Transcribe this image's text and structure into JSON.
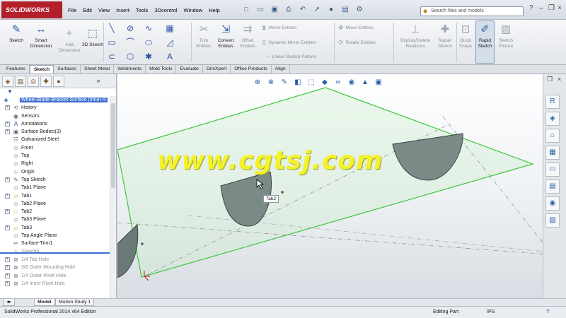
{
  "app": {
    "brand": "SOLIDWORKS",
    "menu": [
      "File",
      "Edit",
      "View",
      "Insert",
      "Tools",
      "3Dcontrol",
      "Window",
      "Help"
    ],
    "search_placeholder": "Search files and models"
  },
  "ribbon": {
    "sketch": "Sketch",
    "smart_dimension": "Smart Dimension",
    "add_dimension": "Add Dimension",
    "sketch_3d": "3D Sketch",
    "trim": "Trim Entities",
    "convert": "Convert Entities",
    "offset": "Offset Entities",
    "mirror": "Mirror Entities",
    "dynamic_mirror": "Dynamic Mirror Entities",
    "linear_pattern": "Linear Sketch Pattern",
    "move": "Move Entities",
    "rotate": "Rotate Entities",
    "display_delete": "Display/Delete Relations",
    "repair": "Repair Sketch",
    "quick_snaps": "Quick Snaps",
    "rapid_sketch": "Rapid Sketch",
    "sketch_picture": "Sketch Picture"
  },
  "tabs": [
    "Features",
    "Sketch",
    "Surfaces",
    "Sheet Metal",
    "Weldments",
    "Mold Tools",
    "Evaluate",
    "DimXpert",
    "Office Products",
    "Align"
  ],
  "active_tab": "Sketch",
  "tree": [
    {
      "label": "Wheel-Blade-Bracket-Surface  (Inner R",
      "icon": "part-icon",
      "sel": true,
      "expand": "",
      "indent": 0
    },
    {
      "label": "History",
      "icon": "history-icon",
      "expand": "+"
    },
    {
      "label": "Sensors",
      "icon": "sensors-icon",
      "expand": ""
    },
    {
      "label": "Annotations",
      "icon": "annotations-icon",
      "expand": "+"
    },
    {
      "label": "Surface Bodies(3)",
      "icon": "surface-bodies-icon",
      "expand": "+"
    },
    {
      "label": "Galvanized Steel",
      "icon": "material-icon",
      "expand": ""
    },
    {
      "label": "Front",
      "icon": "plane-icon",
      "expand": ""
    },
    {
      "label": "Top",
      "icon": "plane-icon",
      "expand": ""
    },
    {
      "label": "Right",
      "icon": "plane-icon",
      "expand": ""
    },
    {
      "label": "Origin",
      "icon": "origin-icon",
      "expand": ""
    },
    {
      "label": "Top Sketch",
      "icon": "sketch-icon",
      "expand": "+"
    },
    {
      "label": "Tab1 Plane",
      "icon": "plane-icon",
      "expand": ""
    },
    {
      "label": "Tab1",
      "icon": "surface-icon",
      "expand": "+"
    },
    {
      "label": "Tab2 Plane",
      "icon": "plane-icon",
      "expand": ""
    },
    {
      "label": "Tab2",
      "icon": "surface-icon",
      "expand": "+"
    },
    {
      "label": "Tab3 Plane",
      "icon": "plane-icon",
      "expand": ""
    },
    {
      "label": "Tab3",
      "icon": "surface-icon",
      "expand": "+"
    },
    {
      "label": "Top Angle Plane",
      "icon": "plane-icon",
      "expand": ""
    },
    {
      "label": "Surface-Trim1",
      "icon": "trim-icon",
      "expand": ""
    },
    {
      "label": "Sketch8",
      "icon": "warning-icon",
      "expand": "",
      "gray": true
    },
    {
      "label": "1/4 Tab Hole",
      "icon": "hole-icon",
      "expand": "+",
      "gray": true
    },
    {
      "label": "3/8 Outer Mounting Hole",
      "icon": "hole-icon",
      "expand": "+",
      "gray": true
    },
    {
      "label": "1/4 Outer Rivet Hole",
      "icon": "hole-icon",
      "expand": "+",
      "gray": true
    },
    {
      "label": "1/4 Inner Rivet Hole",
      "icon": "hole-icon",
      "expand": "+",
      "gray": true
    }
  ],
  "viewport": {
    "watermark": "www.cgtsj.com",
    "tooltip": "Tab2"
  },
  "bottom_tabs": [
    "Model",
    "Motion Study 1"
  ],
  "status": {
    "left": "SolidWorks Professional 2014 x64 Edition",
    "mode": "Editing Part",
    "units": "IPS",
    "help": "?"
  },
  "colors": {
    "accent": "#3b6fd0",
    "plane": "#3cc83c",
    "brand": "#b3202a",
    "watermark": "#f4f22a"
  }
}
